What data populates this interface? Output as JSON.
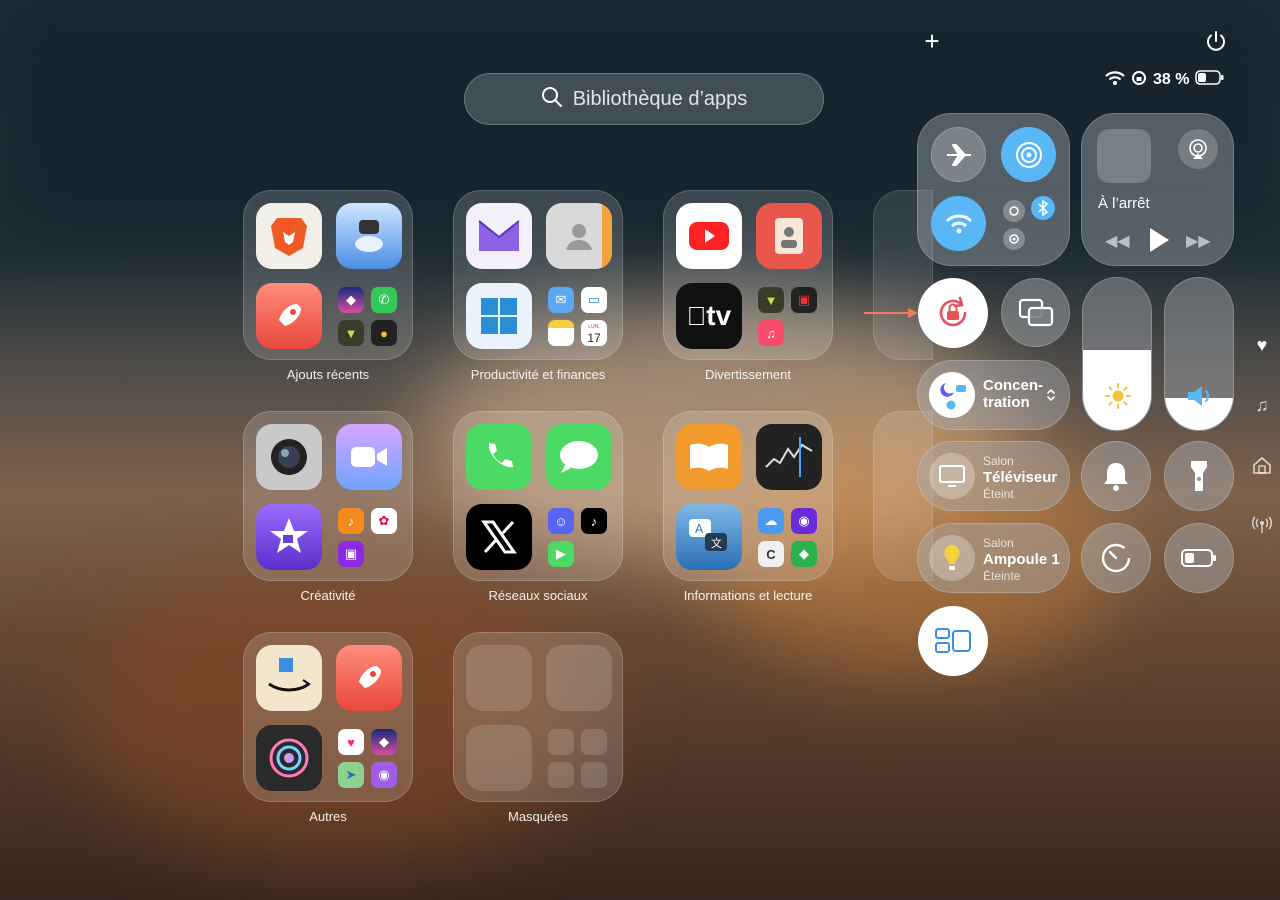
{
  "search": {
    "placeholder": "Bibliothèque d’apps"
  },
  "status": {
    "battery": "38 %"
  },
  "folders": [
    {
      "label": "Ajouts récents"
    },
    {
      "label": "Productivité et finances"
    },
    {
      "label": "Divertissement"
    },
    {
      "label": "Créativité"
    },
    {
      "label": "Réseaux sociaux"
    },
    {
      "label": "Informations et lecture"
    },
    {
      "label": "Autres"
    },
    {
      "label": "Masquées"
    }
  ],
  "apps": {
    "calendar_day": "17",
    "calendar_month": "LUN.",
    "appletv": "tv"
  },
  "control_center": {
    "media": {
      "status": "À l’arrêt"
    },
    "focus": {
      "label": "Concen-\ntration"
    },
    "tv": {
      "room": "Salon",
      "name": "Téléviseur",
      "state": "Éteint"
    },
    "bulb": {
      "room": "Salon",
      "name": "Ampoule 1",
      "state": "Éteinte"
    },
    "brightness_level": 0.52,
    "volume_level": 0.21
  },
  "colors": {
    "accent_blue": "#5ab7f5",
    "rotation_lock_red": "#e8515a",
    "arrow": "#f07c5c"
  }
}
